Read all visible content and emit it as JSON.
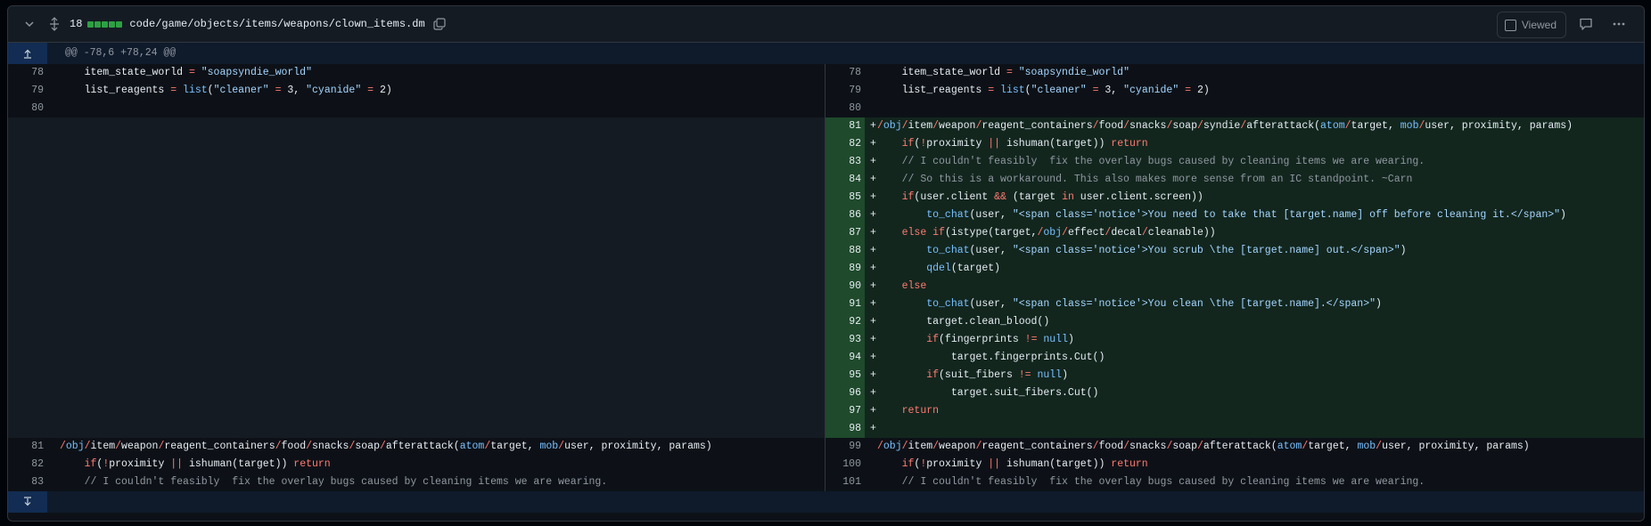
{
  "header": {
    "changes_count": "18",
    "file_path": "code/game/objects/items/weapons/clown_items.dm",
    "viewed_label": "Viewed",
    "addition_color": "#2ea043"
  },
  "hunk": {
    "header": "@@ -78,6 +78,24 @@"
  },
  "context_top": [
    {
      "old": "78",
      "new": "78",
      "code": "    item_state_world = \"soapsyndie_world\""
    },
    {
      "old": "79",
      "new": "79",
      "code": "    list_reagents = list(\"cleaner\" = 3, \"cyanide\" = 2)"
    },
    {
      "old": "80",
      "new": "80",
      "code": ""
    }
  ],
  "additions": [
    {
      "n": "81",
      "code": "/obj/item/weapon/reagent_containers/food/snacks/soap/syndie/afterattack(atom/target, mob/user, proximity, params)"
    },
    {
      "n": "82",
      "code": "    if(!proximity || ishuman(target)) return"
    },
    {
      "n": "83",
      "code": "    // I couldn't feasibly  fix the overlay bugs caused by cleaning items we are wearing."
    },
    {
      "n": "84",
      "code": "    // So this is a workaround. This also makes more sense from an IC standpoint. ~Carn"
    },
    {
      "n": "85",
      "code": "    if(user.client && (target in user.client.screen))"
    },
    {
      "n": "86",
      "code": "        to_chat(user, \"<span class='notice'>You need to take that [target.name] off before cleaning it.</span>\")"
    },
    {
      "n": "87",
      "code": "    else if(istype(target,/obj/effect/decal/cleanable))"
    },
    {
      "n": "88",
      "code": "        to_chat(user, \"<span class='notice'>You scrub \\the [target.name] out.</span>\")"
    },
    {
      "n": "89",
      "code": "        qdel(target)"
    },
    {
      "n": "90",
      "code": "    else"
    },
    {
      "n": "91",
      "code": "        to_chat(user, \"<span class='notice'>You clean \\the [target.name].</span>\")"
    },
    {
      "n": "92",
      "code": "        target.clean_blood()"
    },
    {
      "n": "93",
      "code": "        if(fingerprints != null)"
    },
    {
      "n": "94",
      "code": "            target.fingerprints.Cut()"
    },
    {
      "n": "95",
      "code": "        if(suit_fibers != null)"
    },
    {
      "n": "96",
      "code": "            target.suit_fibers.Cut()"
    },
    {
      "n": "97",
      "code": "    return"
    },
    {
      "n": "98",
      "code": ""
    }
  ],
  "context_bottom": [
    {
      "old": "81",
      "new": "99",
      "code": "/obj/item/weapon/reagent_containers/food/snacks/soap/afterattack(atom/target, mob/user, proximity, params)"
    },
    {
      "old": "82",
      "new": "100",
      "code": "    if(!proximity || ishuman(target)) return"
    },
    {
      "old": "83",
      "new": "101",
      "code": "    // I couldn't feasibly  fix the overlay bugs caused by cleaning items we are wearing."
    }
  ],
  "icons": [
    "chevron-down-icon",
    "unfold-icon",
    "copy-icon",
    "checkbox-icon",
    "comment-icon",
    "kebab-icon",
    "expand-up-icon",
    "expand-down-icon"
  ]
}
